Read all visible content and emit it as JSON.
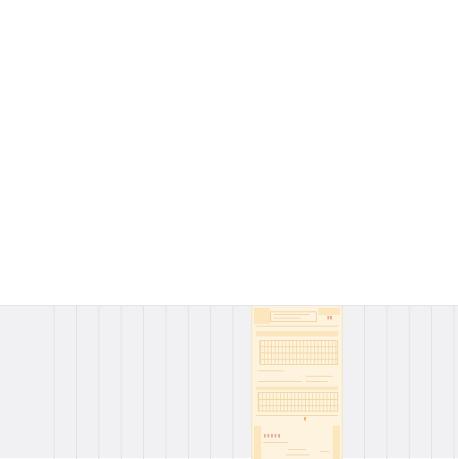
{
  "colors": {
    "background": "#ffffff",
    "workspace": "#f1f1f4",
    "column_line": "#e0e0e6",
    "page_tint": "#fdf3de",
    "page_accent": "#fbe6bd",
    "mark_red": "#e9a78f",
    "mark_orange": "#f2b45f"
  },
  "page_thumbnail": {
    "icon": "document-page-icon"
  }
}
